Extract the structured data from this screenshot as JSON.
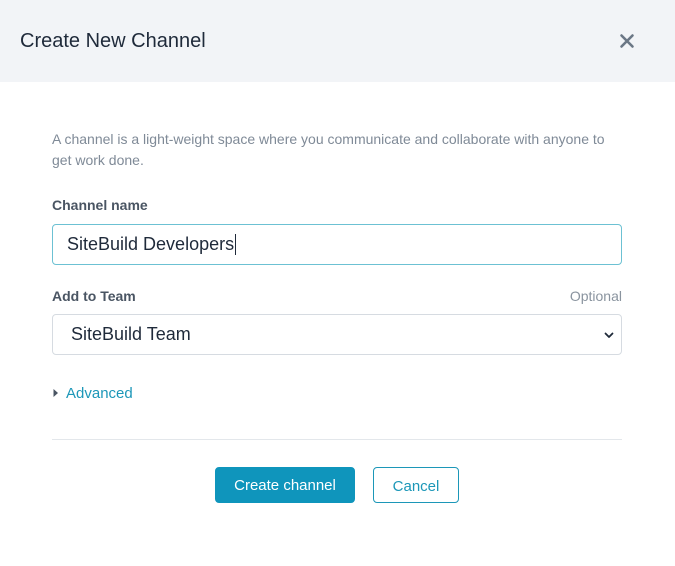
{
  "dialog": {
    "title": "Create New Channel",
    "close_icon": "close-icon"
  },
  "form": {
    "description": "A channel is a light-weight space where you communicate and collaborate with anyone to get work done.",
    "channel_name": {
      "label": "Channel name",
      "value": "SiteBuild Developers"
    },
    "team": {
      "label": "Add to Team",
      "optional_label": "Optional",
      "selected": "SiteBuild Team",
      "icon": "chevron-down-icon"
    },
    "advanced": {
      "label": "Advanced",
      "icon": "caret-right-icon"
    }
  },
  "actions": {
    "create_label": "Create channel",
    "cancel_label": "Cancel"
  },
  "colors": {
    "header_bg": "#f2f4f7",
    "accent": "#0f95bc",
    "link": "#1c97b8",
    "input_focus_border": "#6cc1d3",
    "text_primary": "#1f2a3a",
    "text_muted": "#7f8a97"
  }
}
